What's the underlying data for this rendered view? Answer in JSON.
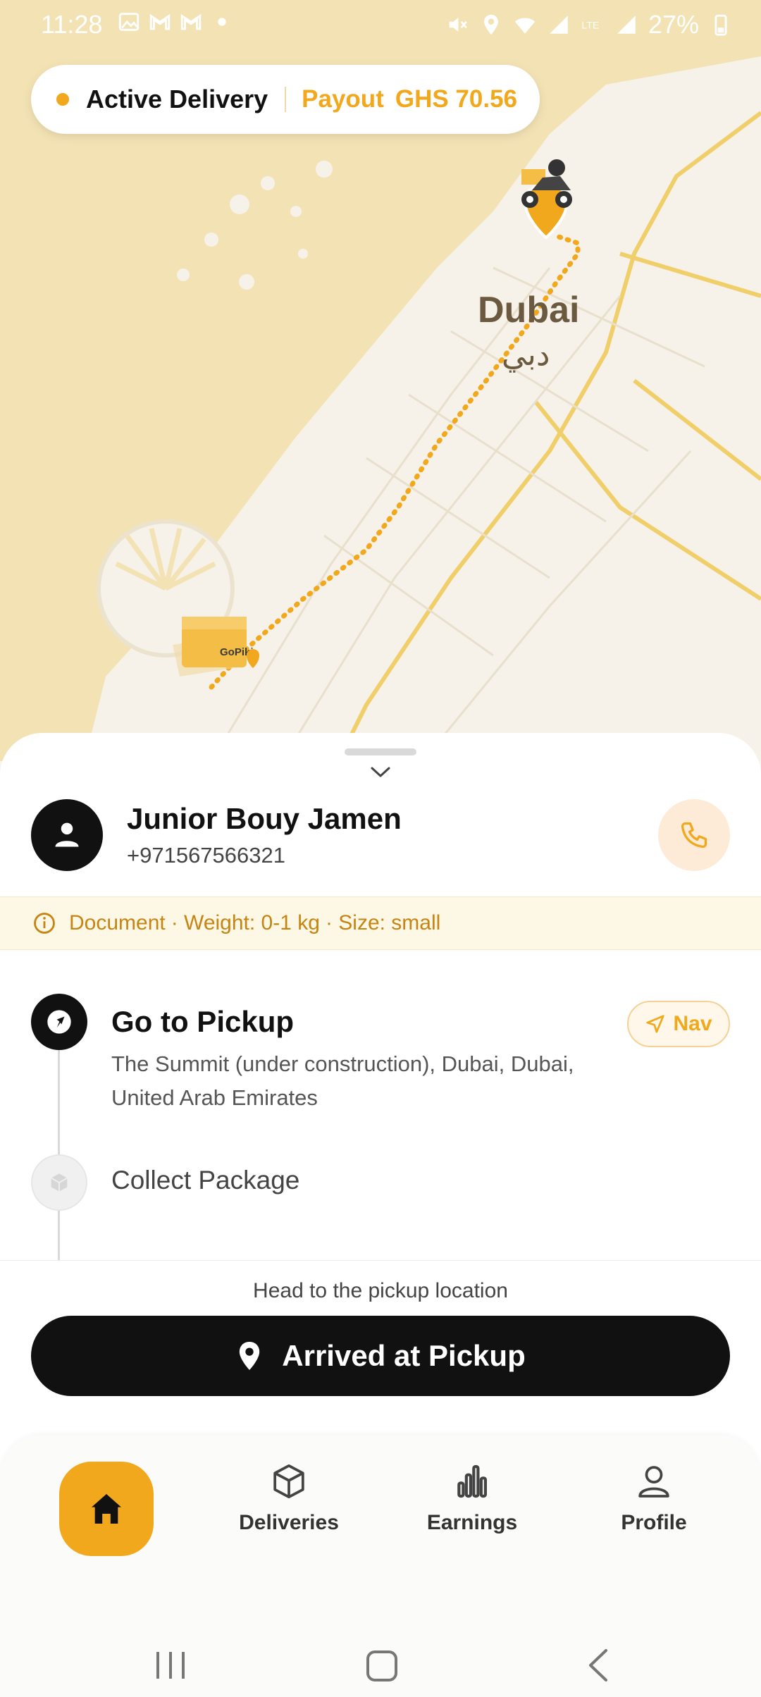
{
  "status_bar": {
    "time": "11:28",
    "battery": "27%"
  },
  "delivery_pill": {
    "status": "Active Delivery",
    "payout_label": "Payout",
    "payout_amount": "GHS 70.56"
  },
  "map": {
    "city_en": "Dubai",
    "city_ar": "دبي",
    "pickup_logo_text": "GoPiki"
  },
  "customer": {
    "name": "Junior Bouy Jamen",
    "phone": "+971567566321"
  },
  "package_info": {
    "type": "Document",
    "weight": "· Weight: 0-1 kg",
    "size": "· Size: small"
  },
  "steps": [
    {
      "title": "Go to Pickup",
      "address": "The Summit (under construction), Dubai, Dubai, United Arab Emirates",
      "nav_label": "Nav"
    },
    {
      "title": "Collect Package"
    }
  ],
  "action": {
    "hint": "Head to the pickup location",
    "button_label": "Arrived at Pickup"
  },
  "bottom_nav": {
    "items": [
      {
        "label": "Home"
      },
      {
        "label": "Deliveries"
      },
      {
        "label": "Earnings"
      },
      {
        "label": "Profile"
      }
    ]
  },
  "colors": {
    "accent": "#f2a81d",
    "dark": "#111111",
    "map_land": "#f3e3b4",
    "map_city": "#f6f2e9"
  }
}
